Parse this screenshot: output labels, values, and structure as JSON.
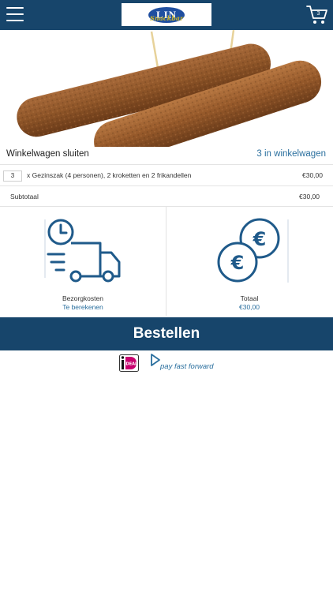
{
  "header": {
    "menu_icon": "hamburger-menu-icon",
    "logo_text": "LIN",
    "logo_script": "Snackbar",
    "cart_count": "3",
    "cart_icon": "shopping-cart-icon"
  },
  "hero": {
    "image": "kroketten-photo"
  },
  "cart": {
    "close_label": "Winkelwagen sluiten",
    "count_label": "3 in winkelwagen",
    "items": [
      {
        "qty": "3",
        "description": "x Gezinszak (4 personen), 2 kroketten en 2 frikandellen",
        "price": "€30,00"
      }
    ],
    "subtotal_label": "Subtotaal",
    "subtotal_value": "€30,00"
  },
  "costs": {
    "delivery_label": "Bezorgkosten",
    "delivery_value": "Te berekenen",
    "delivery_icon": "delivery-truck-clock-icon",
    "total_label": "Totaal",
    "total_value": "€30,00",
    "total_icon": "euro-coins-icon"
  },
  "order_button": "Bestellen",
  "payments": {
    "ideal_icon": "ideal-logo",
    "ideal_text": "iDEAL",
    "payff_icon": "pay-fast-forward-logo",
    "payff_text": "pay fast forward"
  },
  "colors": {
    "primary": "#17456b",
    "accent": "#2a6f9e",
    "icon_blue": "#1f5a8a"
  }
}
